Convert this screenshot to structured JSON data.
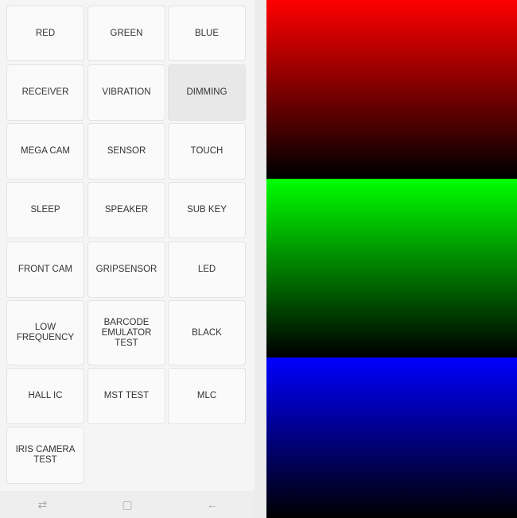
{
  "menu": {
    "buttons": [
      {
        "label": "RED"
      },
      {
        "label": "GREEN"
      },
      {
        "label": "BLUE"
      },
      {
        "label": "RECEIVER"
      },
      {
        "label": "VIBRATION"
      },
      {
        "label": "DIMMING",
        "pressed": true
      },
      {
        "label": "MEGA CAM"
      },
      {
        "label": "SENSOR"
      },
      {
        "label": "TOUCH"
      },
      {
        "label": "SLEEP"
      },
      {
        "label": "SPEAKER"
      },
      {
        "label": "SUB KEY"
      },
      {
        "label": "FRONT CAM"
      },
      {
        "label": "GRIPSENSOR"
      },
      {
        "label": "LED"
      },
      {
        "label": "LOW FREQUENCY"
      },
      {
        "label": "BARCODE EMULATOR TEST"
      },
      {
        "label": "BLACK"
      },
      {
        "label": "HALL IC"
      },
      {
        "label": "MST TEST"
      },
      {
        "label": "MLC"
      },
      {
        "label": "IRIS CAMERA TEST"
      }
    ]
  },
  "navbar": {
    "icons": [
      "recent-apps-icon",
      "home-icon",
      "back-icon"
    ]
  },
  "display": {
    "strips": [
      {
        "name": "red",
        "color": "#ff0000"
      },
      {
        "name": "green",
        "color": "#00ff00"
      },
      {
        "name": "blue",
        "color": "#0000ff"
      }
    ]
  }
}
